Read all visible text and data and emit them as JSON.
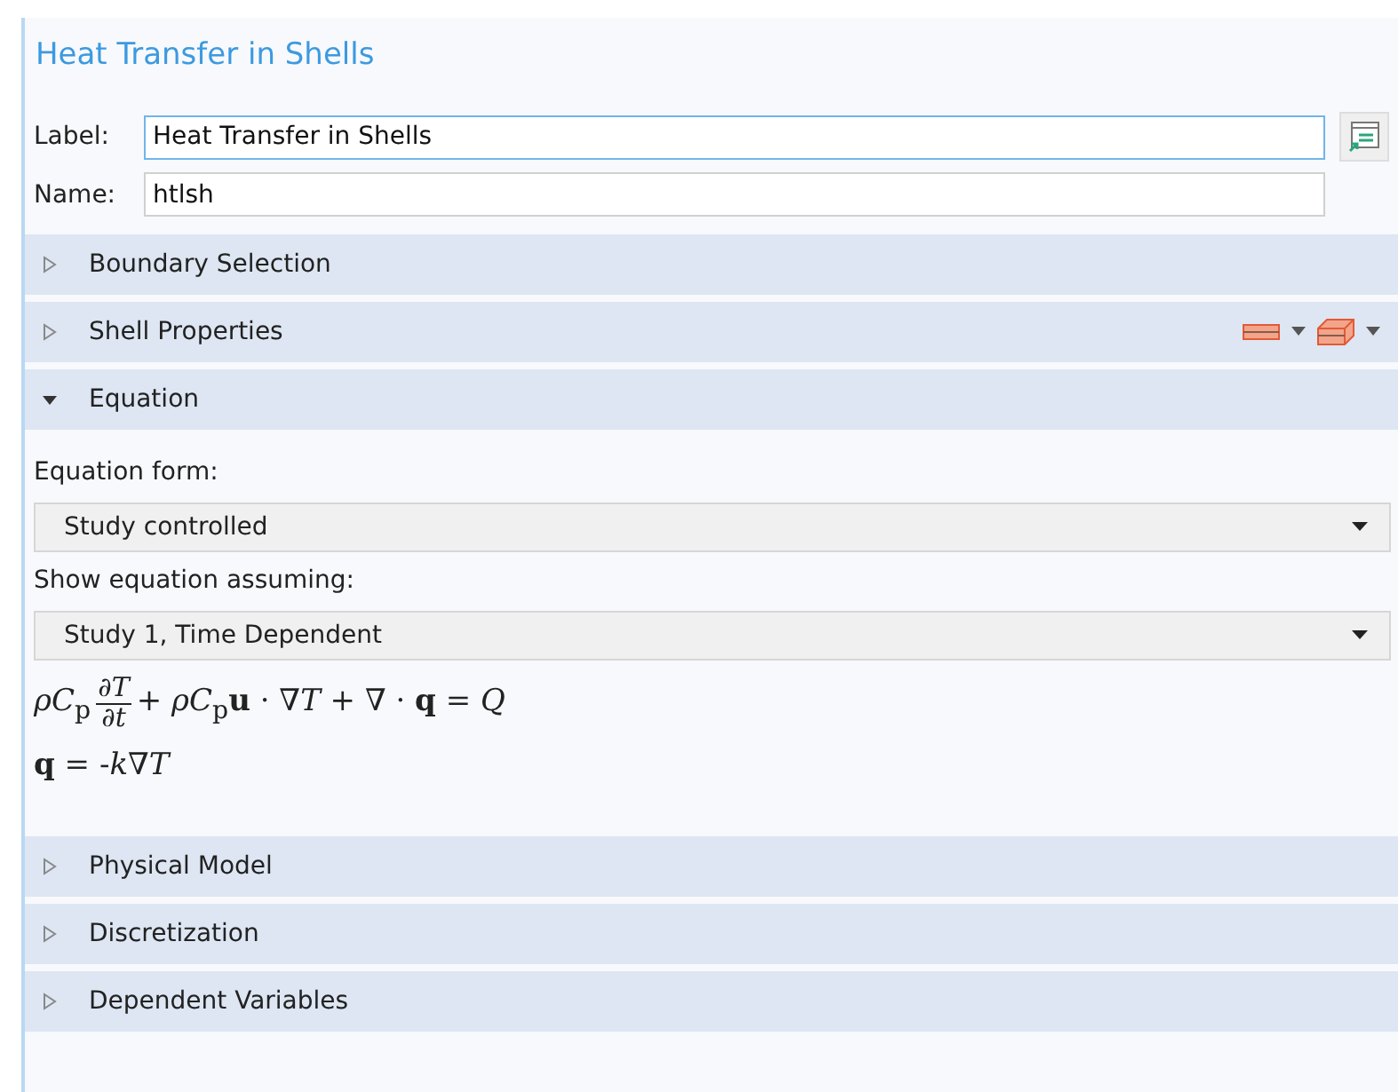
{
  "title": "Heat Transfer in Shells",
  "fields": [
    {
      "label": "Label:",
      "value": "Heat Transfer in Shells",
      "focused": true
    },
    {
      "label": "Name:",
      "value": "htlsh",
      "focused": false
    }
  ],
  "sections": [
    {
      "title": "Boundary Selection",
      "expanded": false
    },
    {
      "title": "Shell Properties",
      "expanded": false,
      "tools": true
    },
    {
      "title": "Equation",
      "expanded": true,
      "content": [
        {
          "kind": "label",
          "text": "Equation form:"
        },
        {
          "kind": "dropdown",
          "value": "Study controlled"
        },
        {
          "kind": "label",
          "text": "Show equation assuming:"
        },
        {
          "kind": "dropdown",
          "value": "Study 1, Time Dependent"
        },
        {
          "kind": "equation",
          "parts": [
            {
              "kind": "text",
              "text": "*ρC*$_{p}$"
            },
            {
              "kind": "fraction",
              "numerator": "∂*T*",
              "denominator": "∂*t*"
            },
            {
              "kind": "text",
              "text": "+ *ρC*$_{p}$**u** · ∇*T* + ∇ · **q** = *Q*"
            }
          ]
        },
        {
          "kind": "equation",
          "parts": [
            {
              "kind": "text",
              "text": "**q** = -*k*∇*T*"
            }
          ]
        }
      ]
    },
    {
      "title": "Physical Model",
      "expanded": false
    },
    {
      "title": "Discretization",
      "expanded": false
    },
    {
      "title": "Dependent Variables",
      "expanded": false
    }
  ]
}
